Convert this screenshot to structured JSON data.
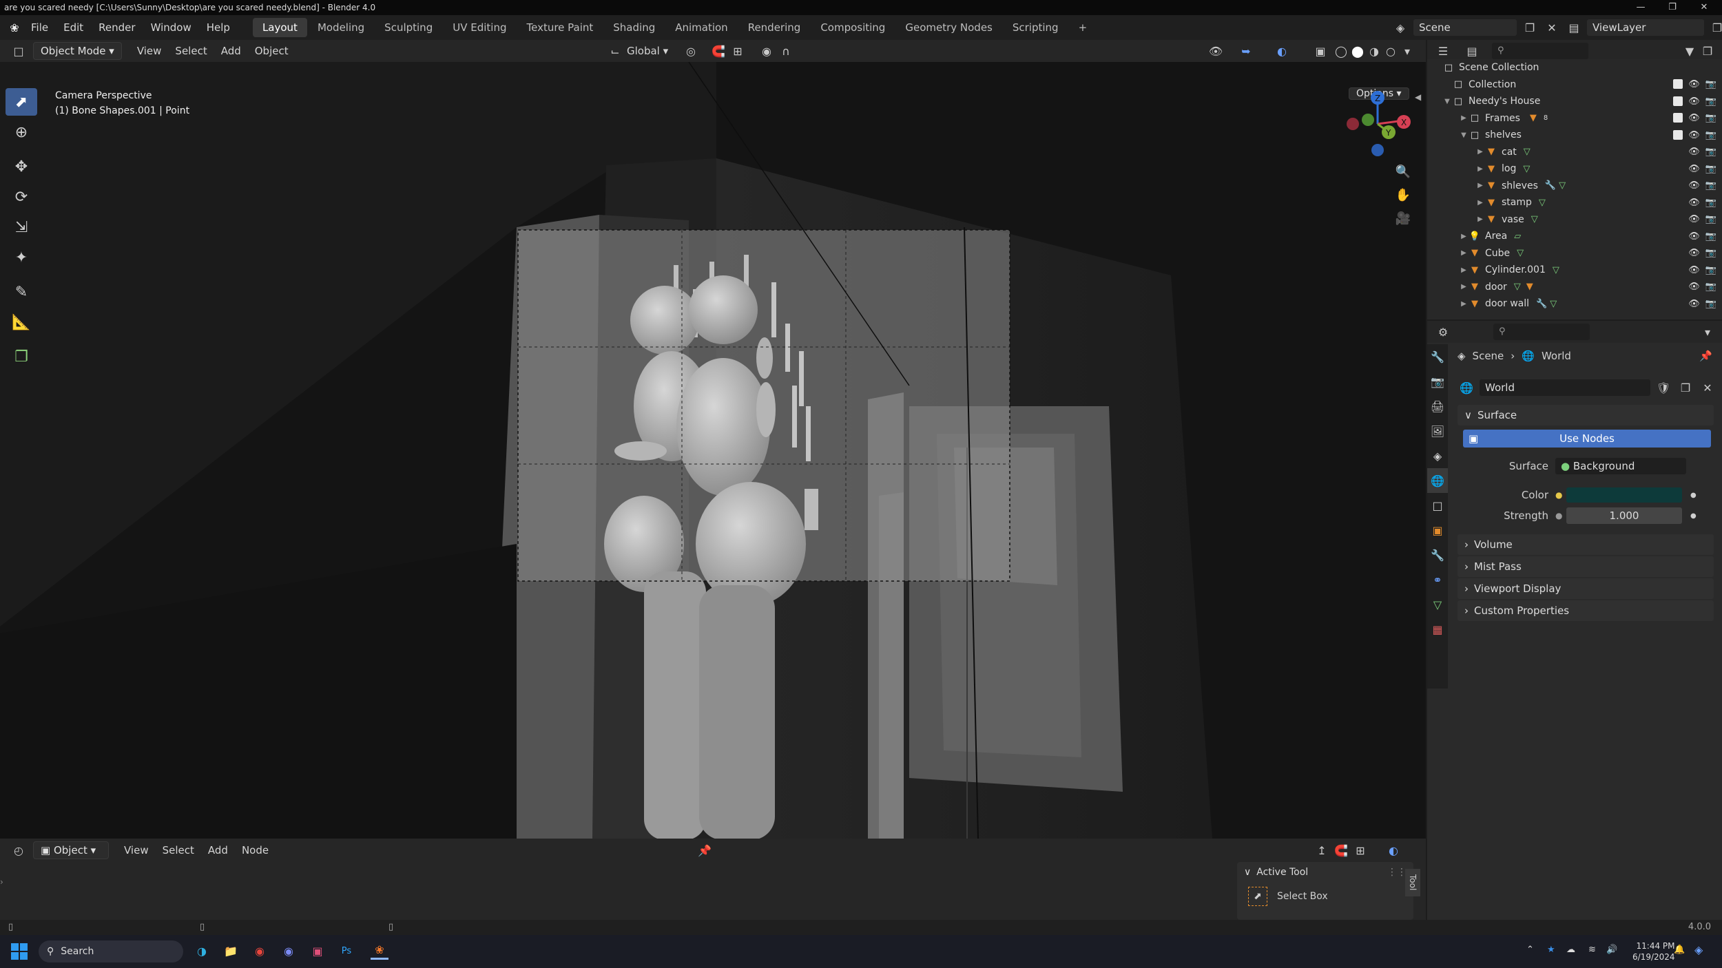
{
  "titlebar": {
    "title": "are you scared needy [C:\\Users\\Sunny\\Desktop\\are you scared needy.blend] - Blender 4.0"
  },
  "menu": [
    "File",
    "Edit",
    "Render",
    "Window",
    "Help"
  ],
  "workspaces": [
    "Layout",
    "Modeling",
    "Sculpting",
    "UV Editing",
    "Texture Paint",
    "Shading",
    "Animation",
    "Rendering",
    "Compositing",
    "Geometry Nodes",
    "Scripting"
  ],
  "active_workspace": "Layout",
  "scene": {
    "name": "Scene",
    "viewlayer": "ViewLayer"
  },
  "viewport_header": {
    "mode": "Object Mode",
    "menus": [
      "View",
      "Select",
      "Add",
      "Object"
    ],
    "transform_orientation": "Global",
    "options_label": "Options"
  },
  "viewport_overlay": {
    "line1": "Camera Perspective",
    "line2": "(1) Bone Shapes.001 | Point"
  },
  "gizmo": {
    "z": "Z",
    "y": "Y",
    "x": "X"
  },
  "outliner": {
    "root": "Scene Collection",
    "rows": [
      {
        "label": "Collection",
        "indent": 1
      },
      {
        "label": "Needy's House",
        "indent": 1
      },
      {
        "label": "Frames",
        "indent": 2,
        "badge": "8"
      },
      {
        "label": "shelves",
        "indent": 2
      },
      {
        "label": "cat",
        "indent": 3
      },
      {
        "label": "log",
        "indent": 3
      },
      {
        "label": "shleves",
        "indent": 3
      },
      {
        "label": "stamp",
        "indent": 3
      },
      {
        "label": "vase",
        "indent": 3
      },
      {
        "label": "Area",
        "indent": 2
      },
      {
        "label": "Cube",
        "indent": 2
      },
      {
        "label": "Cylinder.001",
        "indent": 2
      },
      {
        "label": "door",
        "indent": 2
      },
      {
        "label": "door wall",
        "indent": 2
      }
    ]
  },
  "properties": {
    "breadcrumb_scene": "Scene",
    "breadcrumb_world": "World",
    "world_name": "World",
    "surface_panel": "Surface",
    "use_nodes": "Use Nodes",
    "surface_label": "Surface",
    "surface_value": "Background",
    "color_label": "Color",
    "color_value": "#0d3a3a",
    "strength_label": "Strength",
    "strength_value": "1.000",
    "collapsed_panels": [
      "Volume",
      "Mist Pass",
      "Viewport Display",
      "Custom Properties"
    ]
  },
  "timeline_header": {
    "editor": "Object",
    "menus": [
      "View",
      "Select",
      "Add",
      "Node"
    ]
  },
  "active_tool": {
    "panel": "Active Tool",
    "tool": "Select Box",
    "side_tab": "Tool"
  },
  "status": {
    "version": "4.0.0"
  },
  "taskbar": {
    "search": "Search",
    "time": "11:44 PM",
    "date": "6/19/2024"
  }
}
